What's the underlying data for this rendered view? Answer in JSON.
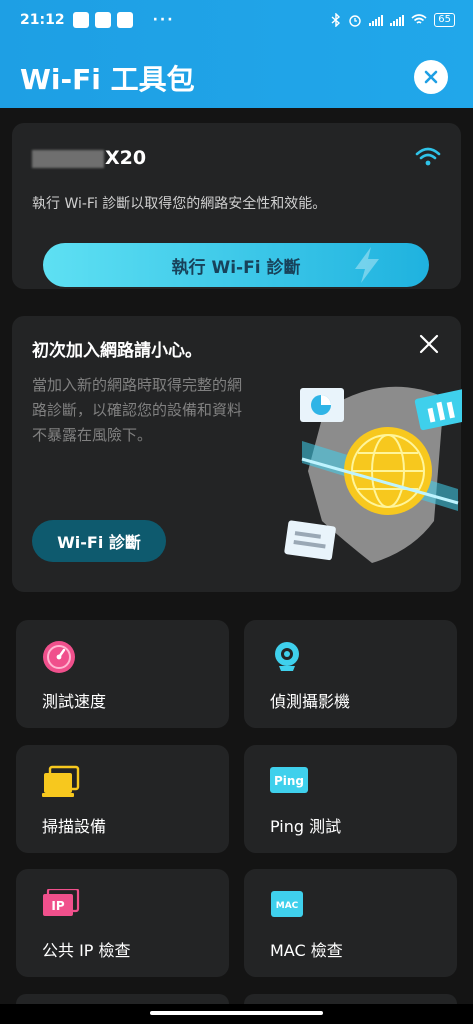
{
  "status": {
    "time": "21:12",
    "dots": "···",
    "battery": "65"
  },
  "header": {
    "title": "Wi-Fi 工具包"
  },
  "wifi_card": {
    "device_name": "X20",
    "description": "執行 Wi-Fi 診斷以取得您的網路安全性和效能。",
    "button_label": "執行 Wi-Fi 診斷"
  },
  "tip_card": {
    "title": "初次加入網路請小心。",
    "description": "當加入新的網路時取得完整的網路診斷，以確認您的設備和資料不暴露在風險下。",
    "button_label": "Wi-Fi 診斷"
  },
  "tools": [
    {
      "label": "測試速度",
      "icon": "speedometer-icon"
    },
    {
      "label": "偵測攝影機",
      "icon": "webcam-icon"
    },
    {
      "label": "掃描設備",
      "icon": "devices-icon"
    },
    {
      "label": "Ping 測試",
      "icon": "ping-icon",
      "badge": "Ping"
    },
    {
      "label": "公共 IP 檢查",
      "icon": "ip-icon",
      "badge": "IP"
    },
    {
      "label": "MAC 檢查",
      "icon": "mac-icon",
      "badge": "MAC"
    }
  ],
  "colors": {
    "header": "#1e9fe4",
    "accent_cyan": "#3fd0ec",
    "pink": "#f0508c",
    "yellow": "#f7c81e",
    "card": "#232425"
  }
}
